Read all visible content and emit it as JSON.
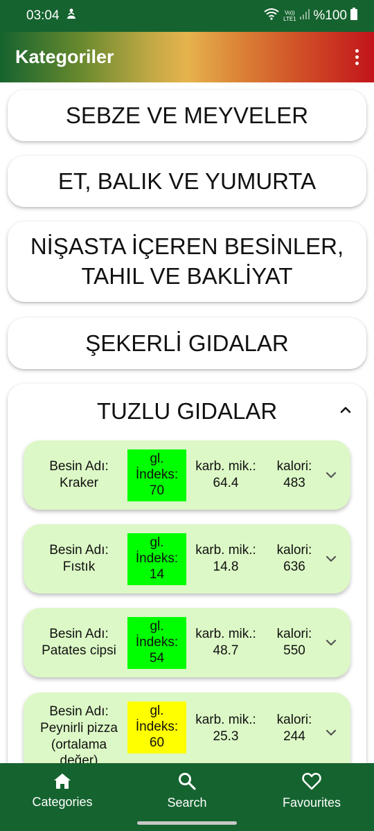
{
  "status_bar": {
    "time": "03:04",
    "network_label": "Vo)) LTE1",
    "battery_text": "%100"
  },
  "app_bar": {
    "title": "Kategoriler",
    "overflow_icon": "more-vert-icon"
  },
  "categories": [
    {
      "label": "SEBZE VE MEYVELER"
    },
    {
      "label": "ET, BALIK VE YUMURTA"
    },
    {
      "label": "NİŞASTA İÇEREN BESİNLER,\nTAHIL VE BAKLİYAT"
    },
    {
      "label": "ŞEKERLİ GIDALAR"
    }
  ],
  "expanded_category": {
    "label": "TUZLU GIDALAR",
    "toggle_icon": "chevron-up-icon",
    "foods": [
      {
        "name_label": "Besin Adı:",
        "name": "Kraker",
        "gi_label_1": "gl.",
        "gi_label_2": "İndeks:",
        "gi_value": "70",
        "gi_color": "#00ff00",
        "carb_label": "karb. mik.:",
        "carb_value": "64.4",
        "cal_label": "kalori:",
        "cal_value": "483"
      },
      {
        "name_label": "Besin Adı:",
        "name": "Fıstık",
        "gi_label_1": "gl.",
        "gi_label_2": "İndeks:",
        "gi_value": "14",
        "gi_color": "#00ff00",
        "carb_label": "karb. mik.:",
        "carb_value": "14.8",
        "cal_label": "kalori:",
        "cal_value": "636"
      },
      {
        "name_label": "Besin Adı:",
        "name": "Patates cipsi",
        "gi_label_1": "gl.",
        "gi_label_2": "İndeks:",
        "gi_value": "54",
        "gi_color": "#00ff00",
        "carb_label": "karb. mik.:",
        "carb_value": "48.7",
        "cal_label": "kalori:",
        "cal_value": "550"
      },
      {
        "name_label": "Besin Adı:",
        "name": "Peynirli pizza (ortalama değer)",
        "gi_label_1": "gl.",
        "gi_label_2": "İndeks:",
        "gi_value": "60",
        "gi_color": "#ffff00",
        "carb_label": "karb. mik.:",
        "carb_value": "25.3",
        "cal_label": "kalori:",
        "cal_value": "244"
      }
    ]
  },
  "bottom_nav": {
    "items": [
      {
        "label": "Categories",
        "icon": "home-icon"
      },
      {
        "label": "Search",
        "icon": "search-icon"
      },
      {
        "label": "Favourites",
        "icon": "heart-icon"
      }
    ]
  },
  "colors": {
    "primary_green": "#15632f",
    "food_card_bg": "#dcf8c6",
    "gi_low": "#00ff00",
    "gi_medium": "#ffff00"
  }
}
